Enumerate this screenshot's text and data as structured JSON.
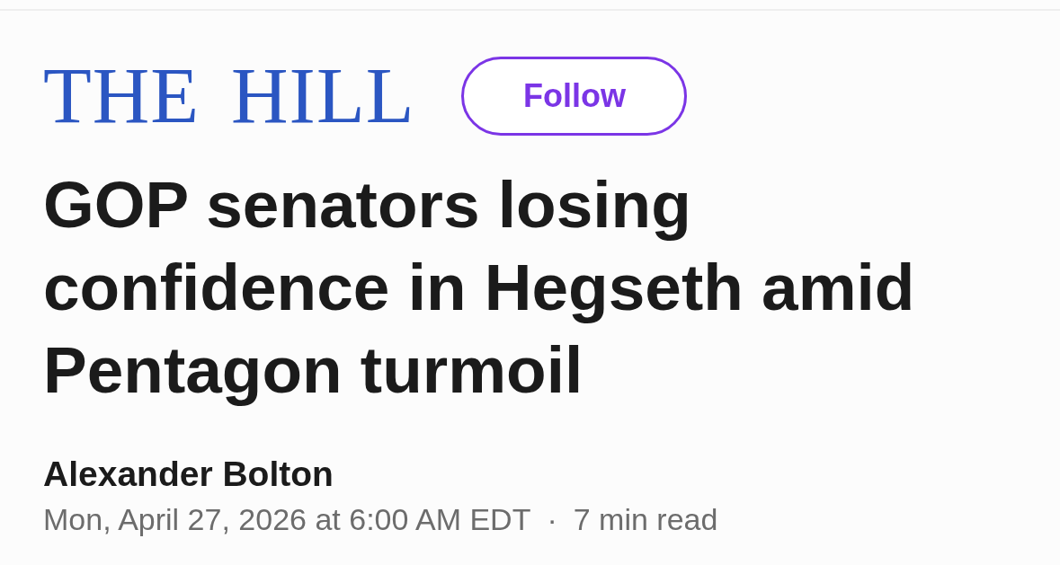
{
  "publisher": {
    "logo": "THE HILL",
    "follow_button": "Follow"
  },
  "article": {
    "headline": "GOP senators losing confidence in Hegseth amid Pentagon turmoil",
    "author": "Alexander Bolton",
    "date": "Mon, April 27, 2026 at 6:00 AM EDT",
    "separator": "·",
    "read_time": "7 min read"
  }
}
